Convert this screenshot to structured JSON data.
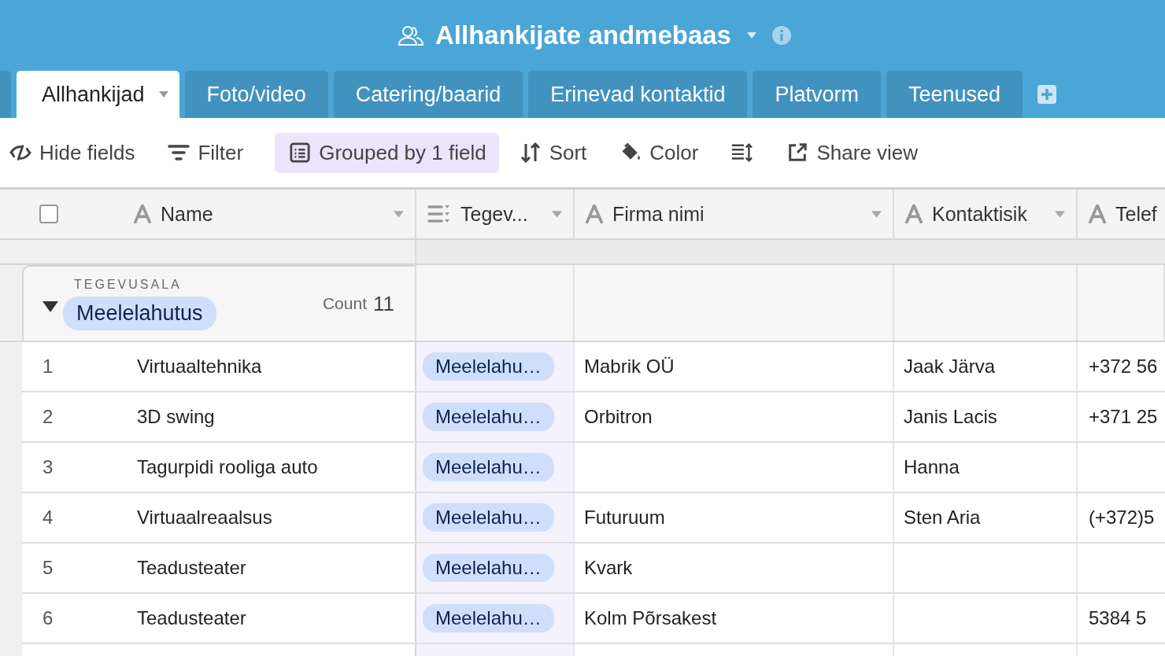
{
  "base": {
    "title": "Allhankijate andmebaas"
  },
  "tabs": [
    {
      "label": "Allhankijad",
      "selected": true
    },
    {
      "label": "Foto/video",
      "selected": false
    },
    {
      "label": "Catering/baarid",
      "selected": false
    },
    {
      "label": "Erinevad kontaktid",
      "selected": false
    },
    {
      "label": "Platvorm",
      "selected": false
    },
    {
      "label": "Teenused",
      "selected": false
    }
  ],
  "toolbar": [
    {
      "kind": "hide",
      "label": "Hide fields",
      "active": false
    },
    {
      "kind": "filter",
      "label": "Filter",
      "active": false
    },
    {
      "kind": "group",
      "label": "Grouped by 1 field",
      "active": true
    },
    {
      "kind": "sort",
      "label": "Sort",
      "active": false
    },
    {
      "kind": "color",
      "label": "Color",
      "active": false
    },
    {
      "kind": "row-height",
      "active": false
    },
    {
      "kind": "share",
      "label": "Share view",
      "active": false
    }
  ],
  "select_all": {
    "checked": false
  },
  "columns": [
    {
      "kind": "text",
      "label": "Name"
    },
    {
      "kind": "select",
      "label": "Tegev..."
    },
    {
      "kind": "text",
      "label": "Firma nimi"
    },
    {
      "kind": "text",
      "label": "Kontaktisik"
    },
    {
      "kind": "text",
      "label": "Telef"
    }
  ],
  "group": {
    "field": "TEGEVUSALA",
    "value": "Meelelahutus",
    "count_label": "Count",
    "count": "11",
    "expanded": true
  },
  "rows": [
    {
      "number": "1",
      "name": "Virtuaaltehnika",
      "tag": "Meelelahu…",
      "firma": "Mabrik OÜ",
      "contact": "Jaak Järva",
      "phone": "+372 56"
    },
    {
      "number": "2",
      "name": "3D swing",
      "tag": "Meelelahu…",
      "firma": "Orbitron",
      "contact": "Janis Lacis",
      "phone": "+371 25"
    },
    {
      "number": "3",
      "name": "Tagurpidi rooliga auto",
      "tag": "Meelelahu…",
      "contact": "Hanna"
    },
    {
      "number": "4",
      "name": "Virtuaalreaalsus",
      "tag": "Meelelahu…",
      "firma": "Futuruum",
      "contact": "Sten Aria",
      "phone": "(+372)5"
    },
    {
      "number": "5",
      "name": "Teadusteater",
      "tag": "Meelelahu…",
      "firma": "Kvark"
    },
    {
      "number": "6",
      "name": "Teadusteater",
      "tag": "Meelelahu…",
      "firma": "Kolm Põrsakest",
      "phone": "5384 5"
    }
  ]
}
